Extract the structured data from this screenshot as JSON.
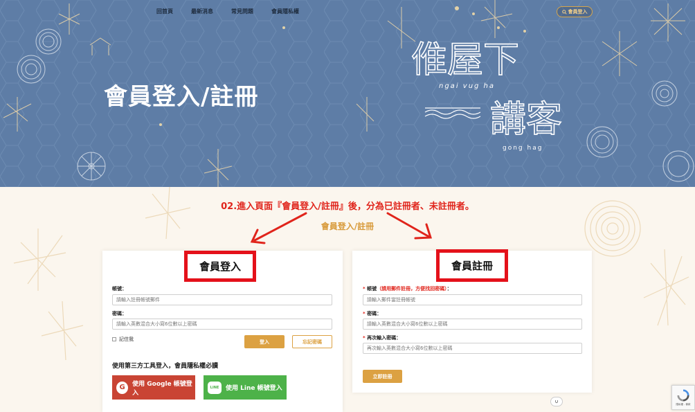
{
  "nav": {
    "items": [
      "回首頁",
      "最新消息",
      "常見問題",
      "會員隱私權"
    ],
    "member_button": "會員登入"
  },
  "hero": {
    "title": "會員登入/註冊",
    "logo": {
      "line1": "倠屋下",
      "romaji1": "ngai vug ha",
      "line2": "講客",
      "romaji2": "gong hag"
    }
  },
  "annotation": "02.進入頁面『會員登入/註冊』後，分為已註冊者、未註冊者。",
  "section_title": "會員登入/註冊",
  "login": {
    "heading": "會員登入",
    "account_label": "帳號：",
    "account_placeholder": "請輸入註冊帳號郵件",
    "password_label": "密碼：",
    "password_placeholder": "請輸入英數混合大小寫6位數以上密碼",
    "remember_label": "記住我",
    "login_button": "登入",
    "forgot_button": "忘記密碼",
    "third_party_label": "使用第三方工具登入，會員隱私權必讀",
    "google_button": "使用 Google 帳號登入",
    "line_button": "使用 Line 帳號登入",
    "line_icon_text": "LINE"
  },
  "register": {
    "heading": "會員註冊",
    "required_mark": "*",
    "account_label": "帳號",
    "account_note": "（請用郵件註冊，方便找回密碼）",
    "account_colon": "：",
    "account_placeholder": "請輸入郵件當註冊帳號",
    "password_label": "密碼：",
    "password_placeholder": "請輸入英數混合大小寫6位數以上密碼",
    "confirm_label": "再次輸入密碼：",
    "confirm_placeholder": "再次輸入英數混合大小寫6位數以上密碼",
    "submit_button": "立即註冊"
  },
  "misc": {
    "scroll_top": "∪",
    "recaptcha_text": "隱私權 - 條款"
  },
  "colors": {
    "hero_bg": "#5e7da6",
    "accent_gold": "#dca142",
    "annotation_red": "#e0241b",
    "google_red": "#c94434",
    "line_green": "#4db249"
  }
}
